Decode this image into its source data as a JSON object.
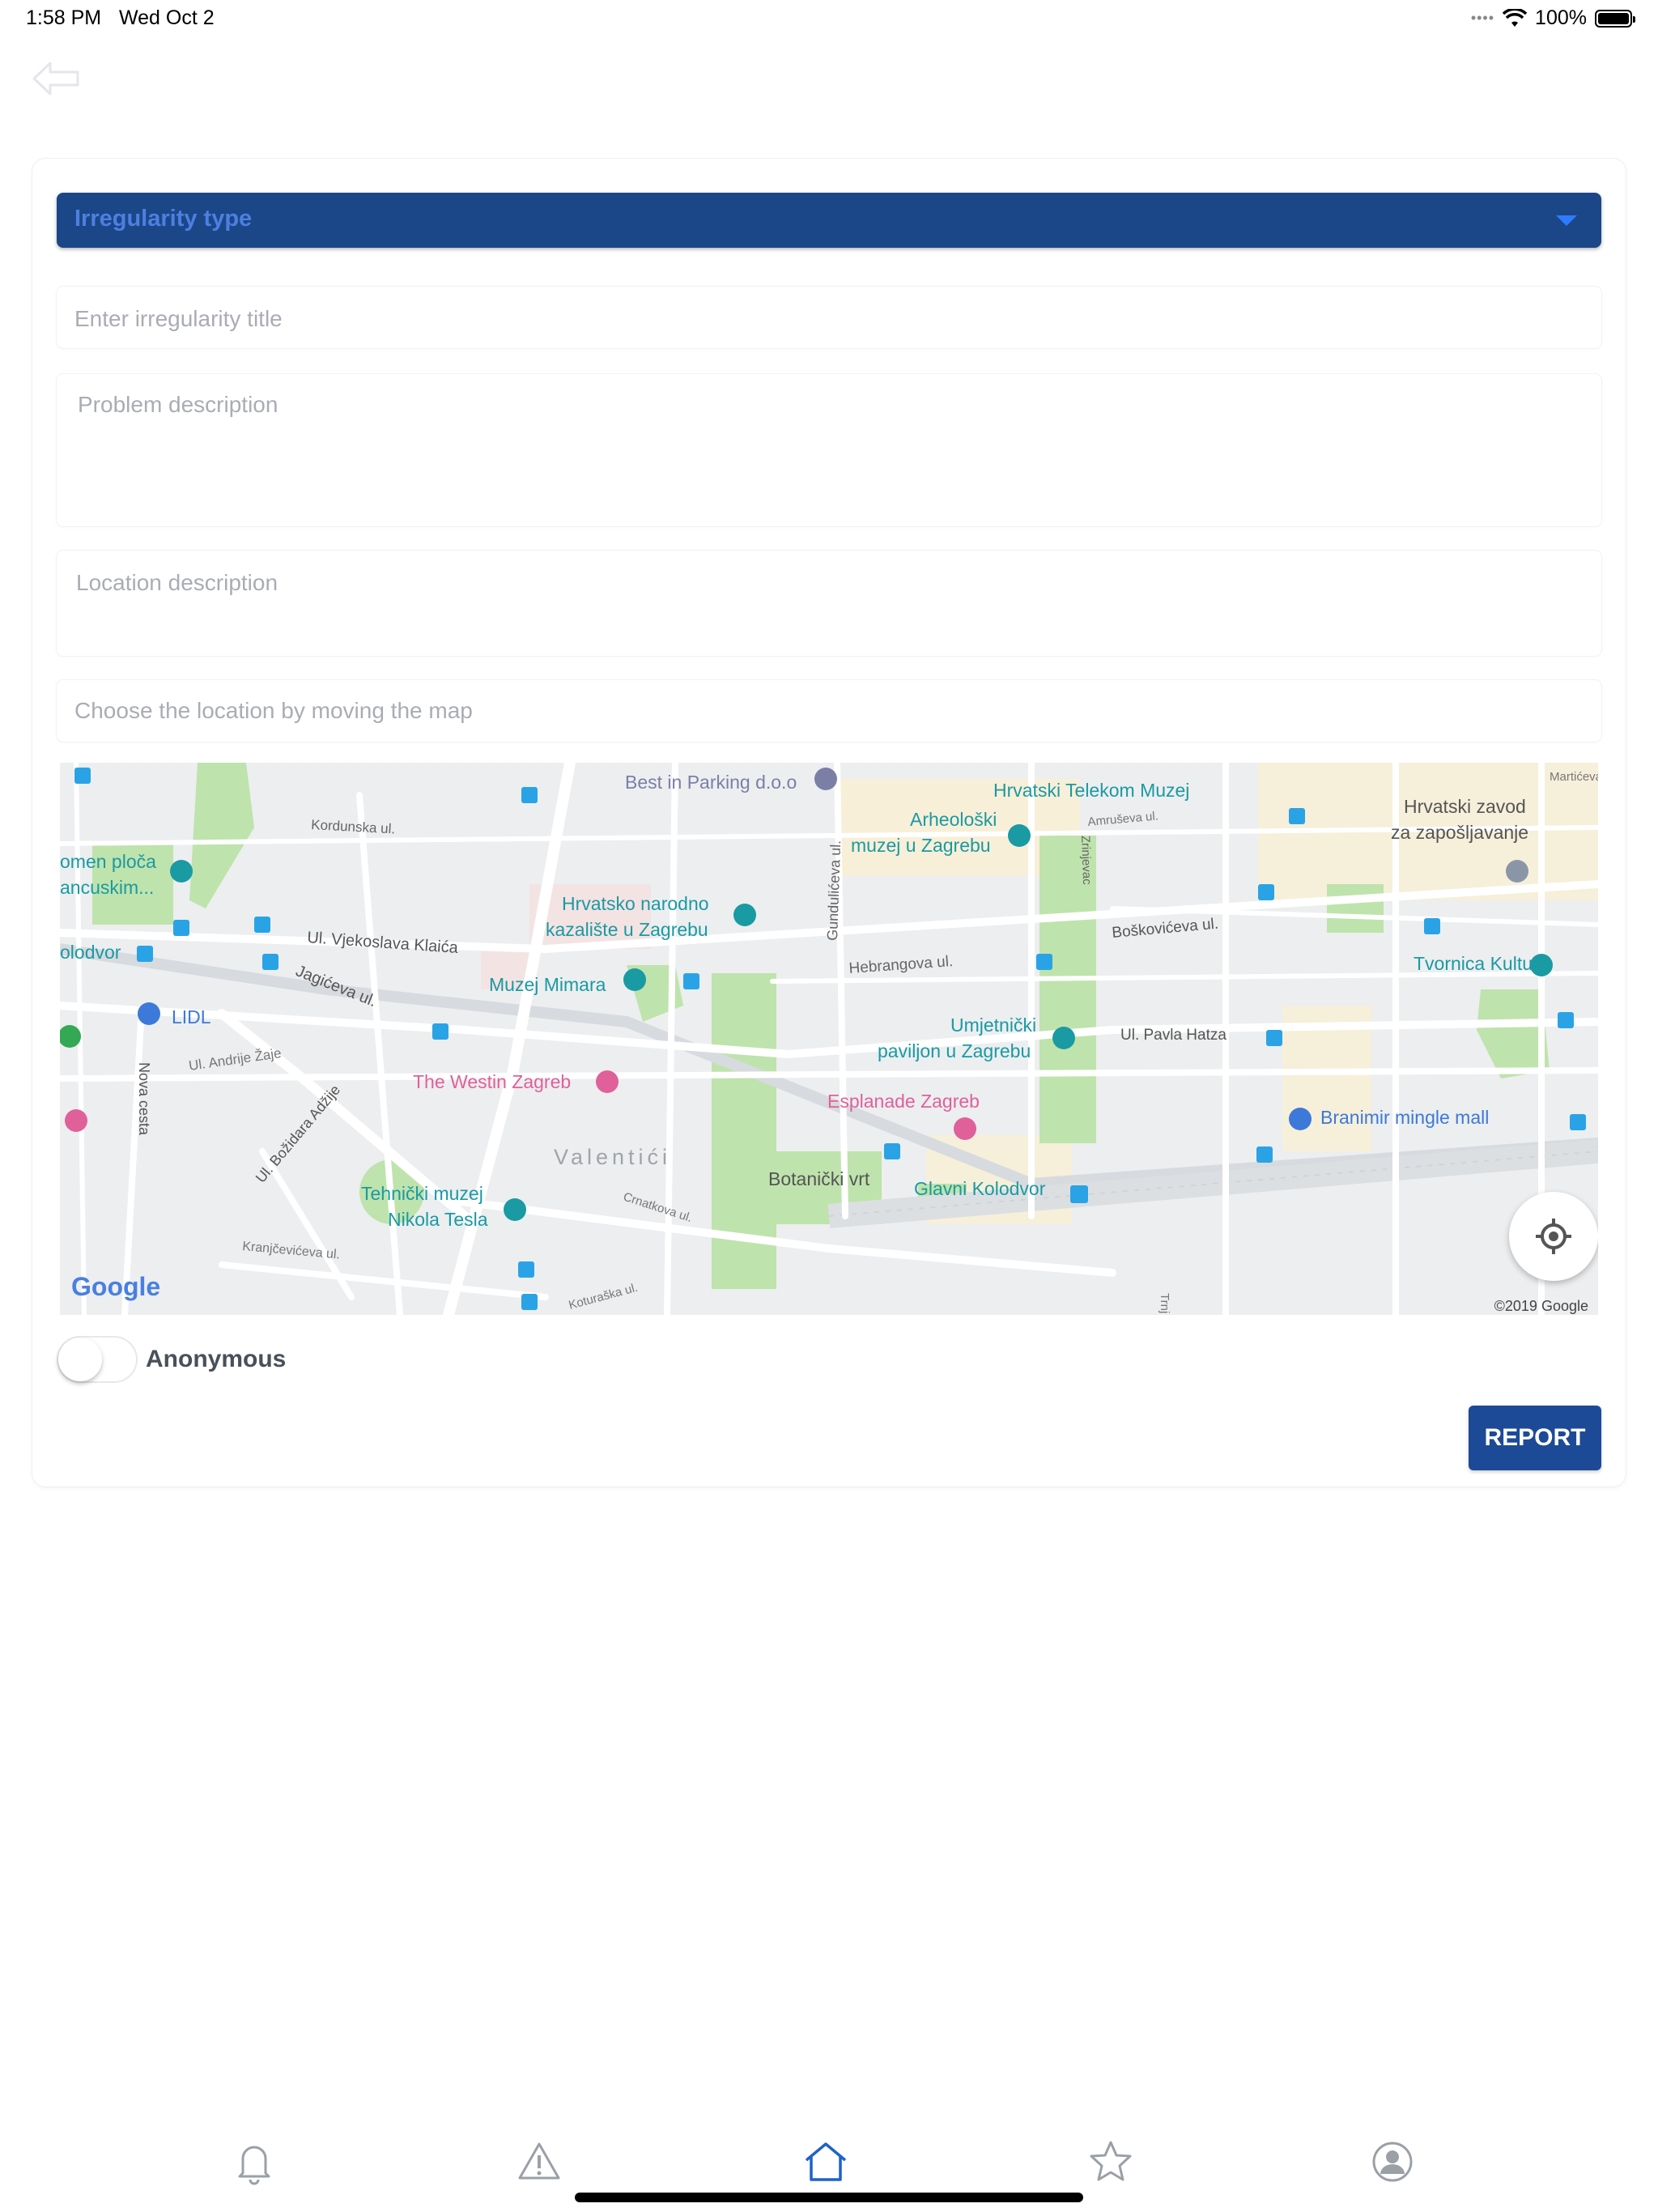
{
  "status_bar": {
    "time": "1:58 PM",
    "date": "Wed Oct 2",
    "battery": "100%",
    "battery_level": 1.0
  },
  "form": {
    "type_select": {
      "label": "Irregularity type"
    },
    "title_input": {
      "placeholder": "Enter irregularity title"
    },
    "problem_input": {
      "placeholder": "Problem description"
    },
    "location_input": {
      "placeholder": "Location description"
    },
    "map_hint": "Choose the location by moving the map",
    "anonymous": {
      "label": "Anonymous",
      "checked": false
    },
    "submit_label": "REPORT"
  },
  "map": {
    "streets": [
      "Kordunska ul.",
      "Ul. Vjekoslava Klaića",
      "Jagićeva ul.",
      "Ul. Andrije Žaje",
      "Nova cesta",
      "Ul. Božidara Adžije",
      "Kranjčevićeva ul.",
      "Koturaška ul.",
      "Crnatkova ul.",
      "Hebrangova ul.",
      "Gundulićeva ul.",
      "Amruševa ul.",
      "Zrinjevac",
      "Boškovićeva ul.",
      "Ul. Pavla Hatza",
      "Martićeva",
      "Trnj"
    ],
    "pois": [
      "Best in Parking d.o.o",
      "Hrvatski Telekom Muzej",
      "Arheološki",
      "muzej u Zagrebu",
      "Hrvatski zavod",
      "za zapošljavanje",
      "omen ploča",
      "ancuskim...",
      "Hrvatsko narodno",
      "kazalište u Zagrebu",
      "olodvor",
      "Tvornica Kulture",
      "Muzej Mimara",
      "LIDL",
      "Umjetnički",
      "paviljon u Zagrebu",
      "The Westin Zagreb",
      "Esplanade Zagreb",
      "Branimir mingle mall",
      "Valentići",
      "Botanički vrt",
      "Glavni Kolodvor",
      "Tehnički muzej",
      "Nikola Tesla"
    ],
    "logo": "Google",
    "copyright": "©2019 Google"
  },
  "tabs": [
    {
      "name": "tab-notifications",
      "icon": "bell-icon",
      "active": false
    },
    {
      "name": "tab-report",
      "icon": "warning-icon",
      "active": false
    },
    {
      "name": "tab-home",
      "icon": "home-icon",
      "active": true
    },
    {
      "name": "tab-favorites",
      "icon": "star-icon",
      "active": false
    },
    {
      "name": "tab-profile",
      "icon": "user-icon",
      "active": false
    }
  ],
  "colors": {
    "primary": "#1d4a97",
    "select_bg": "#1b4788",
    "active_tab": "#1e62c8",
    "inactive_tab": "#9aa0a6",
    "map_poi": "#1a9aa3"
  }
}
